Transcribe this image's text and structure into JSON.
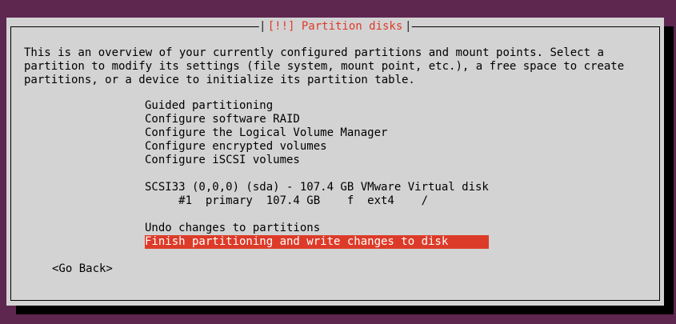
{
  "dialog": {
    "title": "[!!] Partition disks",
    "intro": [
      "This is an overview of your currently configured partitions and mount points. Select a",
      "partition to modify its settings (file system, mount point, etc.), a free space to create",
      "partitions, or a device to initialize its partition table."
    ],
    "menu": [
      "Guided partitioning",
      "Configure software RAID",
      "Configure the Logical Volume Manager",
      "Configure encrypted volumes",
      "Configure iSCSI volumes"
    ],
    "disk": "SCSI33 (0,0,0) (sda) - 107.4 GB VMware Virtual disk",
    "partition": "     #1  primary  107.4 GB    f  ext4    /",
    "undo": "Undo changes to partitions",
    "finish": "Finish partitioning and write changes to disk",
    "go_back": "<Go Back>"
  },
  "colors": {
    "background": "#5e2750",
    "dialog": "#d3d3d3",
    "accent": "#dd3b29"
  }
}
